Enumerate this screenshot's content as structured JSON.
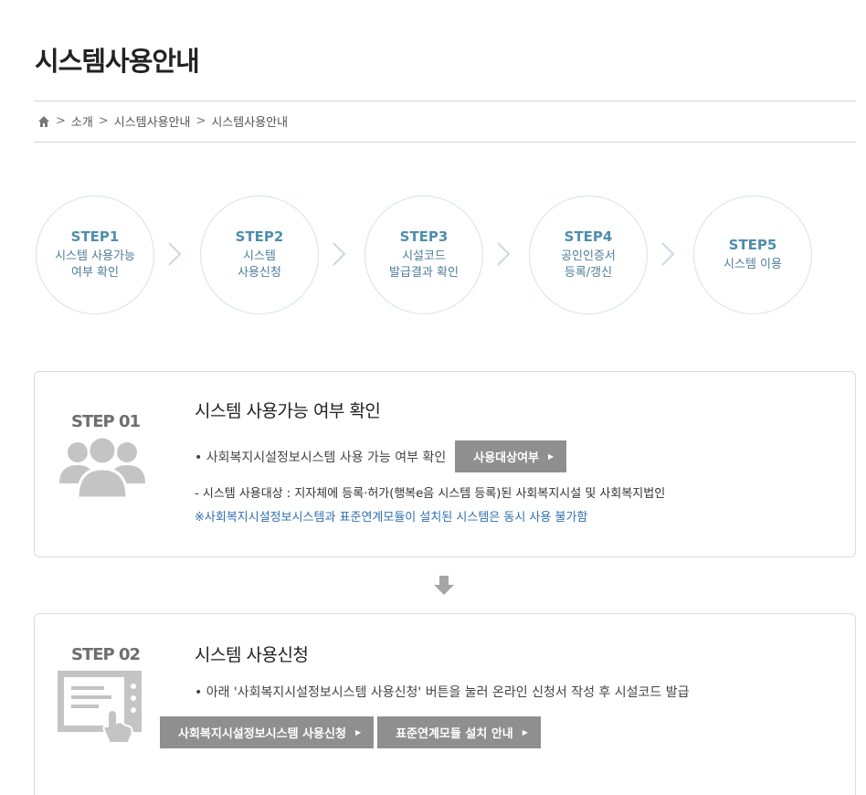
{
  "header": {
    "title": "시스템사용안내"
  },
  "breadcrumb": {
    "items": [
      "소개",
      "시스템사용안내",
      "시스템사용안내"
    ],
    "separator": ">"
  },
  "steps": [
    {
      "num": "STEP1",
      "text": "시스템 사용가능\n여부 확인"
    },
    {
      "num": "STEP2",
      "text": "시스템\n사용신청"
    },
    {
      "num": "STEP3",
      "text": "시설코드\n발급결과 확인"
    },
    {
      "num": "STEP4",
      "text": "공인인증서\n등록/갱신"
    },
    {
      "num": "STEP5",
      "text": "시스템 이용"
    }
  ],
  "step01": {
    "label": "STEP 01",
    "title": "시스템 사용가능 여부 확인",
    "bullet": "• 사회복지시설정보시스템 사용 가능 여부 확인",
    "button": "사용대상여부",
    "note": "- 시스템 사용대상 : 지자체에 등록·허가(행복e음 시스템 등록)된 사회복지시설 및 사회복지법인",
    "warning": "※사회복지시설정보시스템과 표준연계모듈이 설치된 시스템은 동시 사용 불가함"
  },
  "step02": {
    "label": "STEP 02",
    "title": "시스템 사용신청",
    "bullet": "• 아래 '사회복지시설정보시스템 사용신청' 버튼을 눌러 온라인 신청서 작성 후 시설코드 발급",
    "button1": "사회복지시설정보시스템 사용신청",
    "button2": "표준연계모듈 설치 안내"
  },
  "colors": {
    "accent": "#4f8ead",
    "button": "#8f8f8f",
    "warning": "#2f6fb0",
    "icon": "#c4c4c4"
  }
}
